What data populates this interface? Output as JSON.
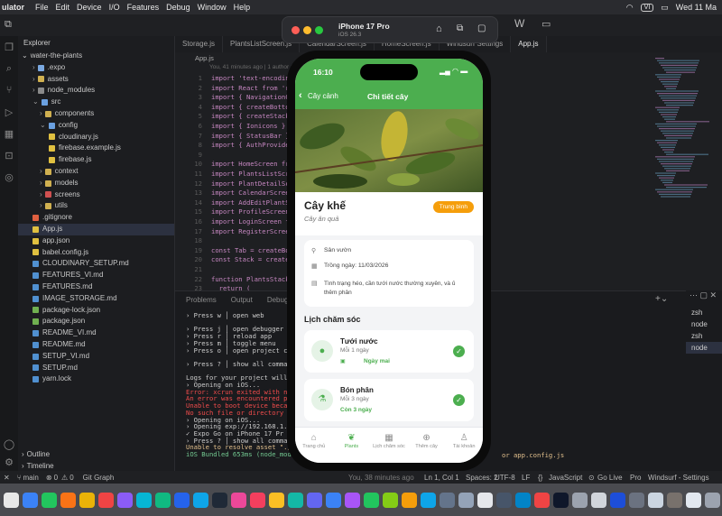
{
  "menubar": {
    "app": "ulator",
    "items": [
      "File",
      "Edit",
      "Device",
      "I/O",
      "Features",
      "Debug",
      "Window",
      "Help"
    ],
    "clock": "Wed 11 Ma",
    "badge": "VI"
  },
  "simulator": {
    "device": "iPhone 17 Pro",
    "os": "iOS 26.3"
  },
  "explorer": {
    "title": "Explorer",
    "root": "water-the-plants",
    "items": [
      {
        "label": ".expo",
        "color": "#7aa8e0"
      },
      {
        "label": "assets",
        "color": "#d0b050"
      },
      {
        "label": "node_modules",
        "color": "#8a8a8a"
      },
      {
        "label": "src",
        "color": "#6aa0e0"
      },
      {
        "label": "components",
        "color": "#d0b050"
      },
      {
        "label": "config",
        "color": "#6aa0e0"
      },
      {
        "label": "cloudinary.js",
        "color": "#e0c040"
      },
      {
        "label": "firebase.example.js",
        "color": "#e0c040"
      },
      {
        "label": "firebase.js",
        "color": "#e0c040"
      },
      {
        "label": "context",
        "color": "#d0b050"
      },
      {
        "label": "models",
        "color": "#d0b050"
      },
      {
        "label": "screens",
        "color": "#d05050"
      },
      {
        "label": "utils",
        "color": "#d0b050"
      },
      {
        "label": ".gitignore",
        "color": "#e06040"
      },
      {
        "label": "App.js",
        "color": "#e0c040"
      },
      {
        "label": "app.json",
        "color": "#e0c040"
      },
      {
        "label": "babel.config.js",
        "color": "#e0c040"
      },
      {
        "label": "CLOUDINARY_SETUP.md",
        "color": "#5090d0"
      },
      {
        "label": "FEATURES_VI.md",
        "color": "#5090d0"
      },
      {
        "label": "FEATURES.md",
        "color": "#5090d0"
      },
      {
        "label": "IMAGE_STORAGE.md",
        "color": "#5090d0"
      },
      {
        "label": "package-lock.json",
        "color": "#70b050"
      },
      {
        "label": "package.json",
        "color": "#70b050"
      },
      {
        "label": "README_VI.md",
        "color": "#5090d0"
      },
      {
        "label": "README.md",
        "color": "#5090d0"
      },
      {
        "label": "SETUP_VI.md",
        "color": "#5090d0"
      },
      {
        "label": "SETUP.md",
        "color": "#5090d0"
      },
      {
        "label": "yarn.lock",
        "color": "#5090d0"
      }
    ],
    "outline": "Outline",
    "timeline": "Timeline"
  },
  "tabs": [
    "Storage.js",
    "PlantsListScreen.js",
    "CalendarScreen.js",
    "HomeScreen.js",
    "Windsurf Settings",
    "App.js"
  ],
  "editor": {
    "breadcrumb": "App.js",
    "blame": "You, 41 minutes ago | 1 author (You)",
    "lines": [
      {
        "n": "1",
        "t": "import 'text-encoding"
      },
      {
        "n": "2",
        "t": "import React from 're"
      },
      {
        "n": "3",
        "t": "import { NavigationCo"
      },
      {
        "n": "4",
        "t": "import { createBotto"
      },
      {
        "n": "5",
        "t": "import { createStackN"
      },
      {
        "n": "6",
        "t": "import { Ionicons } "
      },
      {
        "n": "7",
        "t": "import { StatusBar } "
      },
      {
        "n": "8",
        "t": "import { AuthProvide"
      },
      {
        "n": "9",
        "t": ""
      },
      {
        "n": "10",
        "t": "import HomeScreen fr"
      },
      {
        "n": "11",
        "t": "import PlantsListScr"
      },
      {
        "n": "12",
        "t": "import PlantDetailSc"
      },
      {
        "n": "13",
        "t": "import CalendarScree"
      },
      {
        "n": "14",
        "t": "import AddEditPlantS"
      },
      {
        "n": "15",
        "t": "import ProfileScreen"
      },
      {
        "n": "16",
        "t": "import LoginScreen f"
      },
      {
        "n": "17",
        "t": "import RegisterScree"
      },
      {
        "n": "18",
        "t": ""
      },
      {
        "n": "19",
        "t": "const Tab = createBo"
      },
      {
        "n": "20",
        "t": "const Stack = create"
      },
      {
        "n": "21",
        "t": ""
      },
      {
        "n": "22",
        "t": "function PlantsStack"
      },
      {
        "n": "23",
        "t": "  return ("
      }
    ]
  },
  "panel": {
    "tabs": [
      "Problems",
      "Output",
      "Debug Co"
    ],
    "lines": [
      {
        "t": "› Press w │ open web",
        "c": ""
      },
      {
        "t": "",
        "c": ""
      },
      {
        "t": "› Press j │ open debugger",
        "c": ""
      },
      {
        "t": "› Press r │ reload app",
        "c": ""
      },
      {
        "t": "› Press m │ toggle menu",
        "c": ""
      },
      {
        "t": "› Press o │ open project co",
        "c": ""
      },
      {
        "t": "",
        "c": ""
      },
      {
        "t": "› Press ? │ show all comman",
        "c": ""
      },
      {
        "t": "",
        "c": ""
      },
      {
        "t": "Logs for your project will a",
        "c": ""
      },
      {
        "t": "› Opening on iOS...",
        "c": ""
      },
      {
        "t": "Error: xcrun exited with non",
        "c": "err"
      },
      {
        "t": "An error was encountered pro",
        "c": "err"
      },
      {
        "t": "Unable to boot device becau",
        "c": "err"
      },
      {
        "t": "No such file or directory",
        "c": "err"
      },
      {
        "t": "› Opening on iOS...",
        "c": ""
      },
      {
        "t": "› Opening exp://192.168.1.2",
        "c": ""
      },
      {
        "t": "✓ Expo Go on iPhone 17 Pr",
        "c": ""
      },
      {
        "t": "› Press ? │ show all comman",
        "c": ""
      },
      {
        "t": "Unable to resolve asset \"./a",
        "c": "yel"
      },
      {
        "t": "iOS Bundled 653ms (node_modu",
        "c": "grn"
      }
    ],
    "tail": "or app.config.js",
    "terminals": [
      "zsh",
      "node",
      "zsh",
      "node"
    ]
  },
  "status": {
    "branch": "main",
    "errors": "0",
    "warnings": "0",
    "graph": "Git Graph",
    "blame": "You, 38 minutes ago",
    "pos": "Ln 1, Col 1",
    "spaces": "Spaces: 2",
    "enc": "UTF-8",
    "eol": "LF",
    "lang": "JavaScript",
    "golive": "Go Live",
    "pro": "Pro",
    "ws": "Windsurf - Settings"
  },
  "app": {
    "time": "16:10",
    "back": "Cây cảnh",
    "title": "Chi tiết cây",
    "plant_name": "Cây khế",
    "category": "Cây ăn quả",
    "level": "Trung bình",
    "location": "Sân vườn",
    "planted": "Trồng ngày: 11/03/2026",
    "note": "Tình trạng héo, cần tưới nước thường xuyên, và ủ thêm phân",
    "schedule_title": "Lịch chăm sóc",
    "care": [
      {
        "title": "Tưới nước",
        "freq": "Mỗi 1 ngày",
        "due": "Ngày mai",
        "icon": "water-drop-icon"
      },
      {
        "title": "Bón phân",
        "freq": "Mỗi 3 ngày",
        "due": "Còn 3 ngày",
        "icon": "flask-icon"
      }
    ],
    "tabbar": [
      "Trang chủ",
      "Plants",
      "Lịch chăm sóc",
      "Thêm cây",
      "Tài khoản"
    ],
    "colors": {
      "primary": "#4cae4f",
      "badge": "#f59e0b"
    }
  }
}
